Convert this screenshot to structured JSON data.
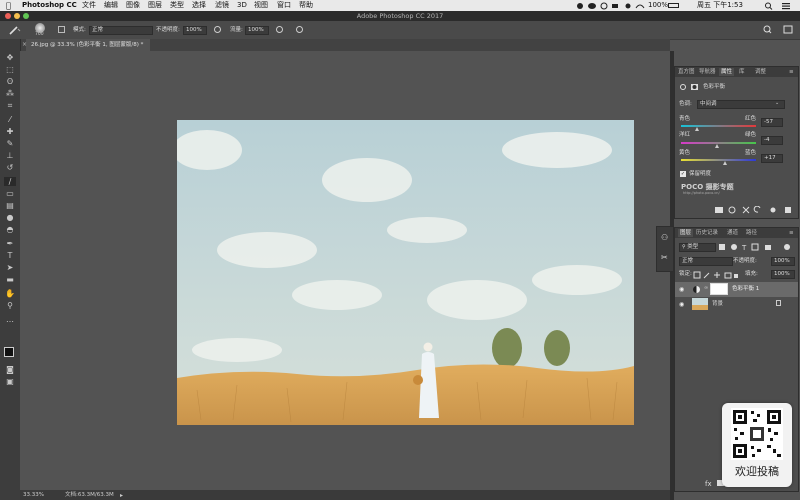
{
  "menubar": {
    "apple_glyph": "",
    "app_name": "Photoshop CC",
    "items": [
      "文件",
      "编辑",
      "图像",
      "图层",
      "类型",
      "选择",
      "滤镜",
      "3D",
      "视图",
      "窗口",
      "帮助"
    ],
    "status": {
      "battery": "100%",
      "clock": "周五 下午1:53"
    }
  },
  "window": {
    "title": "Adobe Photoshop CC 2017"
  },
  "options_bar": {
    "brush_size": "700",
    "mode_label": "模式:",
    "mode_value": "正常",
    "opacity_label": "不透明度:",
    "opacity_value": "100%",
    "flow_label": "流量:",
    "flow_value": "100%"
  },
  "document": {
    "tab_title": "26.jpg @ 33.3% (色彩平衡 1, 图层蒙版/8) *"
  },
  "status_bar": {
    "zoom": "33.33%",
    "doc_info": "文档:63.3M/63.3M"
  },
  "properties_panel": {
    "tabs": [
      "直方图",
      "导航器",
      "属性",
      "库",
      "调整"
    ],
    "active_tab": "属性",
    "title": "色彩平衡",
    "tone_label": "色调:",
    "tone_value": "中间调",
    "sliders": [
      {
        "left": "青色",
        "right": "红色",
        "value": "-57",
        "level": -57
      },
      {
        "left": "洋红",
        "right": "绿色",
        "value": "-4",
        "level": -4
      },
      {
        "left": "黄色",
        "right": "蓝色",
        "value": "+17",
        "level": 17
      }
    ],
    "preserve_label": "保留明度",
    "preserve_checked": true,
    "watermark_brand": "POCO 摄影专题",
    "watermark_url": "http://photo.poco.cn/"
  },
  "layers_panel": {
    "tabs": [
      "图层",
      "历史记录",
      "通道",
      "路径"
    ],
    "active_tab": "图层",
    "filter_label": "类型",
    "blend_mode": "正常",
    "opacity_label": "不透明度:",
    "opacity_value": "100%",
    "lock_label": "锁定:",
    "fill_label": "填充:",
    "fill_value": "100%",
    "layers": [
      {
        "name": "色彩平衡 1",
        "selected": true
      },
      {
        "name": "背景",
        "selected": false
      }
    ]
  },
  "qr_overlay": {
    "caption": "欢迎投稿"
  },
  "colors": {
    "accent": "#2d7be5",
    "panel_bg": "#4d4d4d",
    "canvas_bg": "#535353",
    "grass": "#d8a85a",
    "sky": "#c3d7dc"
  }
}
